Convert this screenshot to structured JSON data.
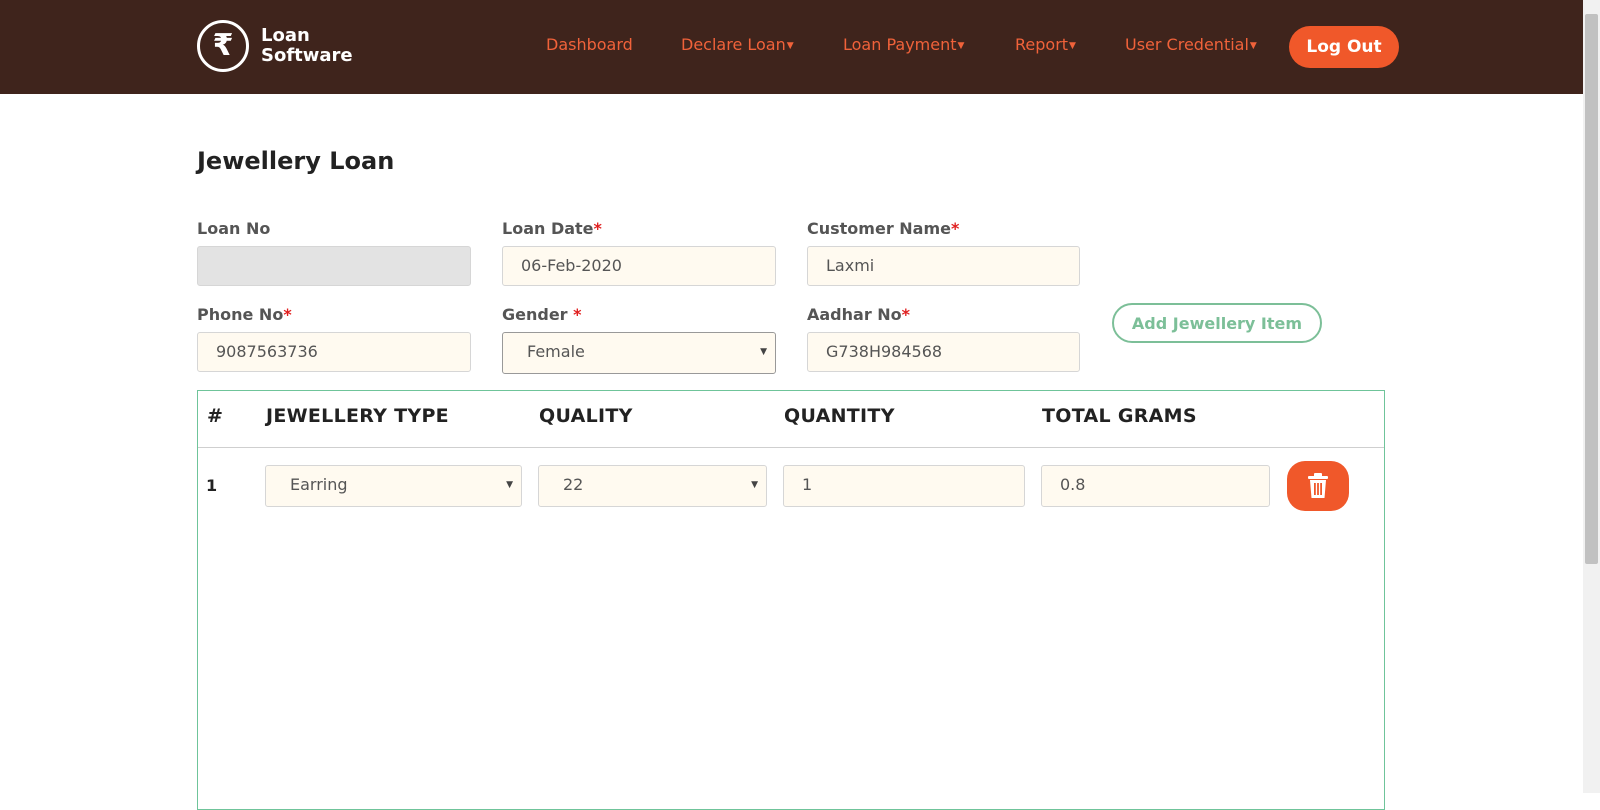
{
  "brand": {
    "symbol": "₹",
    "line1": "Loan",
    "line2": "Software"
  },
  "nav": {
    "dashboard": "Dashboard",
    "declare_loan": "Declare Loan",
    "loan_payment": "Loan Payment",
    "report": "Report",
    "user_credential": "User Credential",
    "logout": "Log Out"
  },
  "page": {
    "title": "Jewellery Loan"
  },
  "form": {
    "loan_no": {
      "label": "Loan No",
      "value": ""
    },
    "loan_date": {
      "label": "Loan Date",
      "value": "06-Feb-2020"
    },
    "customer_name": {
      "label": "Customer Name",
      "value": "Laxmi"
    },
    "phone_no": {
      "label": "Phone No",
      "value": "9087563736"
    },
    "gender": {
      "label": "Gender",
      "value": "Female"
    },
    "aadhar_no": {
      "label": "Aadhar No",
      "value": "G738H984568"
    },
    "required_mark": "*",
    "add_item_label": "Add Jewellery Item"
  },
  "table": {
    "headers": [
      "#",
      "JEWELLERY TYPE",
      "QUALITY",
      "QUANTITY",
      "TOTAL GRAMS"
    ],
    "rows": [
      {
        "num": "1",
        "type": "Earring",
        "quality": "22",
        "quantity": "1",
        "grams": "0.8"
      }
    ]
  },
  "colors": {
    "topbar": "#3f241c",
    "accent": "#f0582a",
    "green": "#7cbf98"
  },
  "icons": {
    "delete": "trash-icon",
    "brand": "rupee-icon"
  }
}
